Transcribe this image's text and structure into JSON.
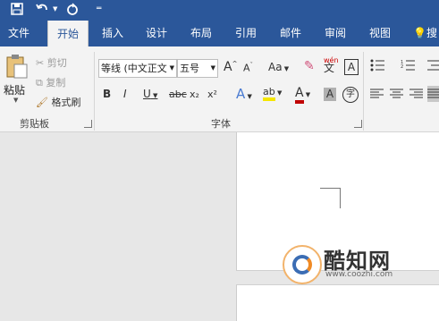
{
  "qat": {
    "save_icon": "save-icon",
    "undo_icon": "undo-icon",
    "redo_icon": "redo-icon",
    "customize_icon": "customize-qat-icon"
  },
  "tabs": [
    {
      "label": "文件"
    },
    {
      "label": "开始"
    },
    {
      "label": "插入"
    },
    {
      "label": "设计"
    },
    {
      "label": "布局"
    },
    {
      "label": "引用"
    },
    {
      "label": "邮件"
    },
    {
      "label": "审阅"
    },
    {
      "label": "视图"
    }
  ],
  "tell_me": {
    "label": "搜"
  },
  "clipboard": {
    "paste_label": "粘贴",
    "cut_label": "剪切",
    "copy_label": "复制",
    "format_painter_label": "格式刷",
    "group_label": "剪贴板"
  },
  "font": {
    "font_name": "等线 (中文正文",
    "font_size": "五号",
    "grow": "A",
    "shrink": "A",
    "change_case": "Aa",
    "phonetic": "wén",
    "border_char": "A",
    "bold": "B",
    "italic": "I",
    "underline": "U",
    "strike": "abc",
    "subscript": "x₂",
    "superscript": "x²",
    "effects": "A",
    "highlight": "ab",
    "font_color": "A",
    "shading": "A",
    "enclose": "字",
    "group_label": "字体"
  },
  "colors": {
    "brand": "#2b579a",
    "ribbon_bg": "#f3f3f3",
    "highlight": "#f5e600",
    "font_color": "#c00000"
  },
  "watermark": {
    "title": "酷知网",
    "url": "www.coozhi.com"
  }
}
